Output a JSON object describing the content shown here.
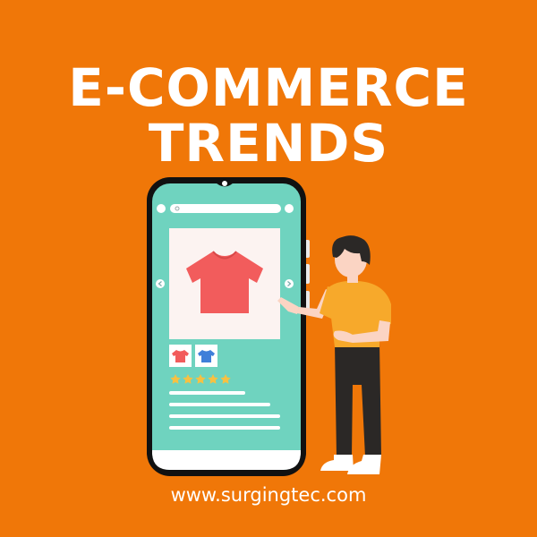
{
  "headline": {
    "line1": "E-COMMERCE",
    "line2": "TRENDS"
  },
  "website": "www.surgingtec.com",
  "product_card": {
    "rating_stars": 5,
    "rating_max": 5,
    "product_icon": "tshirt-icon",
    "thumbnail_colors": [
      "#f25c5c",
      "#3f7fd9"
    ]
  },
  "colors": {
    "background": "#f07708",
    "phone_screen": "#6fd3bf",
    "phone_body": "#111111",
    "shirt": "#f25c5c",
    "star": "#f6c143",
    "person_shirt": "#f7a92b",
    "person_pants": "#2b2826"
  }
}
